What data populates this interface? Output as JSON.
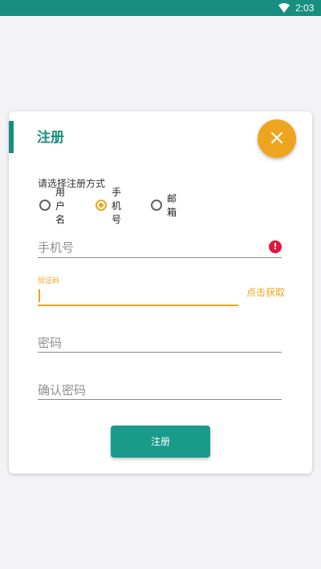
{
  "status_bar": {
    "time": "2:03",
    "icons": [
      "wifi-icon"
    ]
  },
  "dialog": {
    "title": "注册",
    "close_icon": "close-icon",
    "method_label": "请选择注册方式",
    "methods": [
      {
        "label": "用户名",
        "checked": false
      },
      {
        "label": "手机号",
        "checked": true
      },
      {
        "label": "邮箱",
        "checked": false
      }
    ],
    "phone": {
      "placeholder": "手机号",
      "value": "",
      "error_icon": "alert-icon"
    },
    "code": {
      "label": "验证码",
      "value": "",
      "get_code": "点击获取"
    },
    "password": {
      "placeholder": "密码",
      "value": ""
    },
    "confirm_password": {
      "placeholder": "确认密码",
      "value": ""
    },
    "submit_label": "注册"
  },
  "colors": {
    "primary": "#168f80",
    "button": "#1a9a8a",
    "accent": "#eda41e",
    "error": "#e0163d",
    "background": "#f3f3f6"
  }
}
